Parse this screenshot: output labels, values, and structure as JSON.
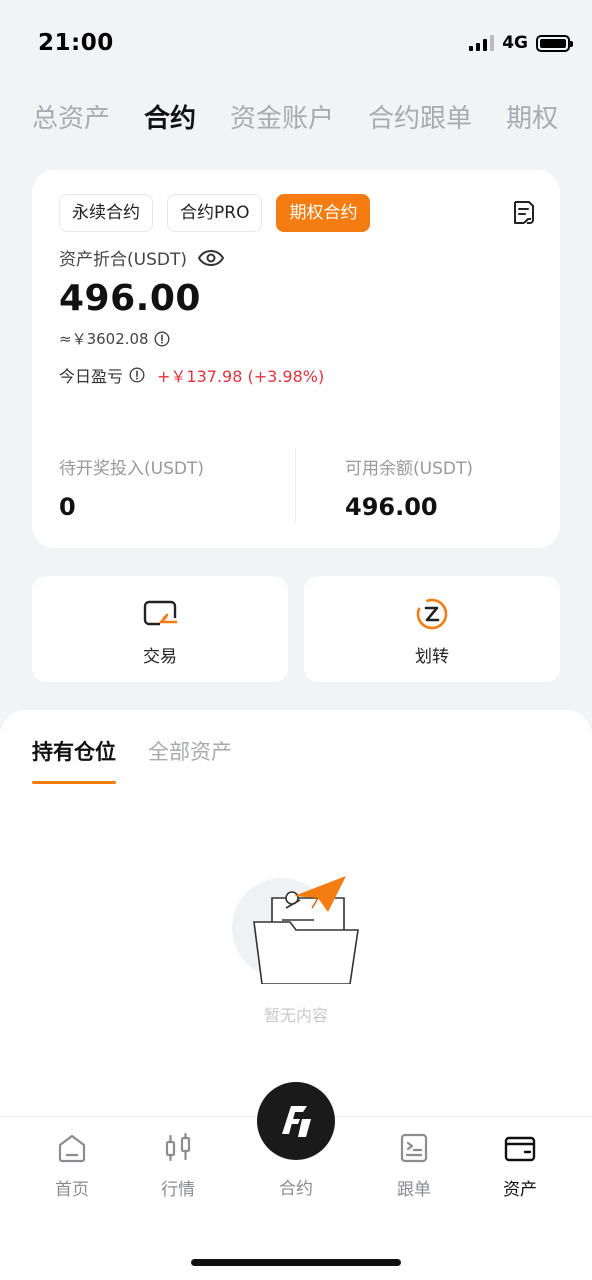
{
  "status": {
    "time": "21:00",
    "network": "4G"
  },
  "top_tabs": [
    {
      "label": "总资产"
    },
    {
      "label": "合约"
    },
    {
      "label": "资金账户"
    },
    {
      "label": "合约跟单"
    },
    {
      "label": "期权"
    }
  ],
  "top_tabs_active_index": 1,
  "card": {
    "chips": [
      {
        "label": "永续合约"
      },
      {
        "label": "合约PRO"
      },
      {
        "label": "期权合约"
      }
    ],
    "chips_active_index": 2,
    "asset_label": "资产折合(USDT)",
    "asset_value": "496.00",
    "cny_value": "≈￥3602.08",
    "pnl_label": "今日盈亏",
    "pnl_value": "+￥137.98 (+3.98%)",
    "stat_left": {
      "label": "待开奖投入(USDT)",
      "value": "0"
    },
    "stat_right": {
      "label": "可用余额(USDT)",
      "value": "496.00"
    }
  },
  "actions": [
    {
      "label": "交易",
      "icon": "trade-icon"
    },
    {
      "label": "划转",
      "icon": "transfer-icon"
    }
  ],
  "panel": {
    "tabs": [
      {
        "label": "持有仓位"
      },
      {
        "label": "全部资产"
      }
    ],
    "tabs_active_index": 0,
    "empty_text": "暂无内容"
  },
  "tabbar": {
    "items": [
      {
        "label": "首页",
        "icon": "home-icon"
      },
      {
        "label": "行情",
        "icon": "candlestick-icon"
      },
      {
        "label": "合约",
        "icon": "contract-logo-icon"
      },
      {
        "label": "跟单",
        "icon": "copy-trade-icon"
      },
      {
        "label": "资产",
        "icon": "wallet-icon"
      }
    ],
    "active_index": 4
  },
  "colors": {
    "accent": "#f57c10",
    "profit": "#e0343c",
    "background": "#f2f3f5",
    "muted_text": "#a9abb0"
  }
}
